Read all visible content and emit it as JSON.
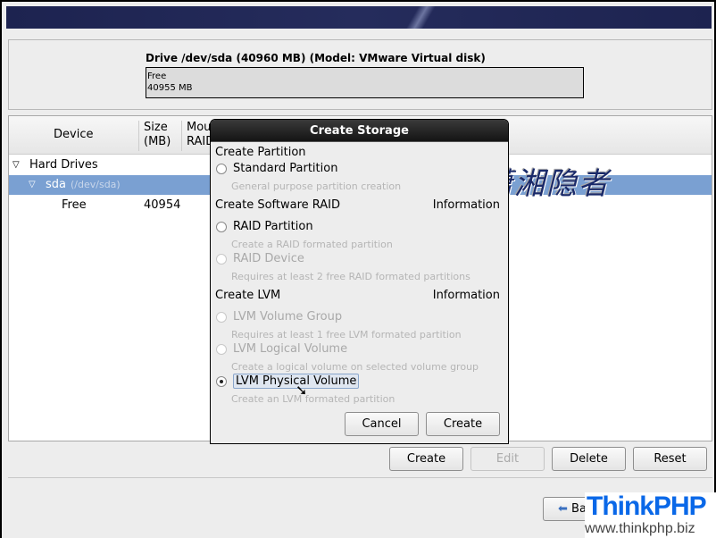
{
  "drive": {
    "label": "Drive /dev/sda (40960 MB) (Model: VMware Virtual disk)",
    "bar_name": "Free",
    "bar_size": "40955 MB"
  },
  "tree": {
    "columns": [
      "Device",
      "Size\n(MB)",
      "Mou\nRAID"
    ],
    "col_device": "Device",
    "col_size_1": "Size",
    "col_size_2": "(MB)",
    "col_mount_1": "Mou",
    "col_mount_2": "RAID",
    "group": "Hard Drives",
    "disk": "sda",
    "disk_path": "(/dev/sda)",
    "free_label": "Free",
    "free_size": "40954"
  },
  "dialog": {
    "title": "Create Storage",
    "sec_partition": "Create Partition",
    "standard": "Standard Partition",
    "standard_desc": "General purpose partition creation",
    "sec_raid": "Create Software RAID",
    "info": "Information",
    "raid_part": "RAID Partition",
    "raid_part_desc": "Create a RAID formated partition",
    "raid_dev": "RAID Device",
    "raid_dev_desc": "Requires at least 2 free RAID formated partitions",
    "sec_lvm": "Create LVM",
    "lvm_vg": "LVM Volume Group",
    "lvm_vg_desc": "Requires at least 1 free LVM formated partition",
    "lvm_lv": "LVM Logical Volume",
    "lvm_lv_desc": "Create a logical volume on selected volume group",
    "lvm_pv": "LVM Physical Volume",
    "lvm_pv_desc": "Create an LVM formated partition",
    "selected": "LVM Physical Volume",
    "cancel": "Cancel",
    "create": "Create"
  },
  "actions": {
    "create": "Create",
    "edit": "Edit",
    "delete": "Delete",
    "reset": "Reset"
  },
  "nav": {
    "back": "Back"
  },
  "watermarks": {
    "cn": "潇湘隐者",
    "brand": "ThinkPHP",
    "url": "www.thinkphp.biz"
  },
  "colors": {
    "selection": "#7aa0d2",
    "banner": "#1d2350",
    "brand": "#0a68e8"
  }
}
